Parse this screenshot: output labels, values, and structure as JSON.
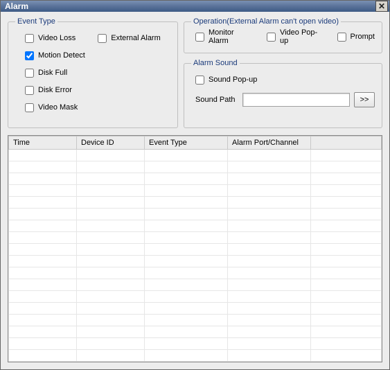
{
  "window": {
    "title": "Alarm",
    "close_symbol": "✕"
  },
  "event_type": {
    "legend": "Event Type",
    "video_loss": {
      "label": "Video Loss",
      "checked": false
    },
    "external_alarm": {
      "label": "External Alarm",
      "checked": false
    },
    "motion_detect": {
      "label": "Motion Detect",
      "checked": true
    },
    "disk_full": {
      "label": "Disk Full",
      "checked": false
    },
    "disk_error": {
      "label": "Disk Error",
      "checked": false
    },
    "video_mask": {
      "label": "Video Mask",
      "checked": false
    }
  },
  "operation": {
    "legend": "Operation(External Alarm can't open video)",
    "monitor_alarm": {
      "label": "Monitor Alarm",
      "checked": false
    },
    "video_popup": {
      "label": "Video Pop-up",
      "checked": false
    },
    "prompt": {
      "label": "Prompt",
      "checked": false
    }
  },
  "alarm_sound": {
    "legend": "Alarm Sound",
    "sound_popup": {
      "label": "Sound Pop-up",
      "checked": false
    },
    "sound_path_label": "Sound Path",
    "sound_path_value": "",
    "browse_label": ">>"
  },
  "table": {
    "columns": [
      "Time",
      "Device ID",
      "Event Type",
      "Alarm Port/Channel",
      ""
    ],
    "col_widths": [
      "98px",
      "98px",
      "120px",
      "120px",
      "auto"
    ],
    "rows": 18
  }
}
